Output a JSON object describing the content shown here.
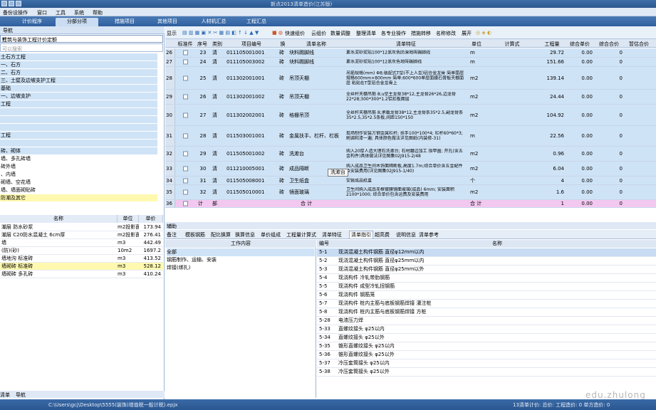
{
  "window": {
    "title": "新点2013清单造价(江苏版)"
  },
  "menu": [
    "备份设操作",
    "窗口",
    "工具",
    "系统",
    "帮助"
  ],
  "tabs": [
    "计价程序",
    "分部分项",
    "措施项目",
    "其他项目",
    "人材机汇总",
    "工程汇总"
  ],
  "left": {
    "header": "导航",
    "selector": "建筑与装饰工程计价定额",
    "search_placeholder": "可以搜索",
    "tree": [
      "土石方工程",
      "一、石方",
      "二、石方",
      "三、土壁及边坡支护工程",
      "基础",
      "一、边坡支护",
      "工程",
      "",
      "",
      " ",
      "工程",
      " ",
      "砖、砌体",
      "墙、多孔砖墙",
      "砖外墙",
      "、内墙",
      "砌墙、空花墙",
      "墙、墙面砌贴砖",
      "防潮及其它"
    ],
    "list_headers": [
      "名称",
      "单位",
      "单价"
    ],
    "list": [
      {
        "name": "潮层 防水砂浆",
        "unit": "m2投影面",
        "price": "173.94"
      },
      {
        "name": "潮层 C20防水混凝土 6cm厚",
        "unit": "m2投影面",
        "price": "276.41"
      },
      {
        "name": "墙",
        "unit": "m3",
        "price": "442.49"
      },
      {
        "name": "(防)(砂)",
        "unit": "10m2",
        "price": "1697.2"
      },
      {
        "name": "墙地沟 标准砖",
        "unit": "m3",
        "price": "413.52"
      },
      {
        "name": "墙砌砖 标准砖",
        "unit": "m3",
        "price": "528.12"
      },
      {
        "name": "墙砌砖 多孔砖",
        "unit": "m3",
        "price": "410.24"
      }
    ],
    "tabs": [
      "清单",
      "导航"
    ]
  },
  "toolbar": [
    "显示",
    "快速组价",
    "云组价",
    "数量调整",
    "整理清单",
    "各专业操作",
    "措施转移",
    "名称修改",
    "展开"
  ],
  "grid": {
    "headers": [
      "",
      "标准件",
      "序号",
      "类别",
      "项目编号",
      "换",
      "清单名称",
      "清单特征",
      "单位",
      "计算式",
      "工程量",
      "综合单价",
      "综合合价",
      "暂估合价"
    ],
    "rows": [
      {
        "n": "26",
        "seq": "23",
        "type": "清",
        "code": "011105001001",
        "unit_mark": "砖",
        "name": "块料踢脚线",
        "feat": "素水泥砂浆贴100*12黑灰色防滑地砖踢脚线",
        "unit": "m",
        "qty": "29.72",
        "price": "0.00",
        "total": "0"
      },
      {
        "n": "27",
        "seq": "24",
        "type": "清",
        "code": "011105003002",
        "unit_mark": "砖",
        "name": "块料踢脚线",
        "feat": "素水泥砂浆贴100*12黑灰色地砖踢脚线",
        "unit": "m",
        "qty": "151.66",
        "price": "0.00",
        "total": "0"
      },
      {
        "n": "28",
        "seq": "25",
        "type": "清",
        "code": "011302001001",
        "unit_mark": "砖",
        "name": "吊顶天棚",
        "feat": "吊筋规格(mm) Φ8;装配式T型(不上人型)铝合金龙骨 简单面层规格600mm×800mm 简单;600*600单层面膜石膏板天棚面层 粘贴在T型铝合金龙骨上",
        "unit": "m2",
        "qty": "139.14",
        "price": "0.00",
        "total": "0"
      },
      {
        "n": "29",
        "seq": "26",
        "type": "清",
        "code": "011302001002",
        "unit_mark": "砖",
        "name": "吊顶天棚",
        "feat": "全丝杆天棚吊筋 8;u型主龙骨38*12,主龙骨26*26,边龙骨22*28;300*300*1.2铝扣板面层",
        "unit": "m2",
        "qty": "24.44",
        "price": "0.00",
        "total": "0"
      },
      {
        "n": "30",
        "seq": "27",
        "type": "清",
        "code": "011302002001",
        "unit_mark": "砖",
        "name": "格栅吊顶",
        "feat": "全丝杆天棚吊筋 8;承载龙骨38*12,主龙骨条35*2.5,副龙骨条35*2.5,35*2.5条板,间距150*150",
        "unit": "m2",
        "qty": "104.92",
        "price": "0.00",
        "total": "0"
      },
      {
        "n": "31",
        "seq": "28",
        "type": "清",
        "code": "011503001001",
        "unit_mark": "砖",
        "name": "金属扶手、栏杆、栏板",
        "feat": "现场制作安装方钢金属栏杆; 扶手100*100*4; 栏杆60*60*3; 刷调和漆一遍; 具体颜色做法详见图纸(内装修-31)",
        "unit": "m",
        "qty": "22.56",
        "price": "0.00",
        "total": "0"
      },
      {
        "n": "32",
        "seq": "29",
        "type": "清",
        "code": "011505001002",
        "unit_mark": "砖",
        "name": "洗漱台",
        "feat": "购入20厚人造大理石洗漱台; 石材磨边加工 指甲圆; 开孔(含五金构件)具体做法详见图集02J915-2/48",
        "unit": "m2",
        "qty": "0.96",
        "price": "0.00",
        "total": "0"
      },
      {
        "n": "33",
        "seq": "30",
        "type": "清",
        "code": "011210005001",
        "unit_mark": "砖",
        "name": "成品隔断",
        "feat": "购入成品卫生间木饰面隔断板,高度1.7m;综合单价含五金配件及安装费用(详见图集02J915-1/40)",
        "unit": "m2",
        "qty": "6.04",
        "price": "0.00",
        "total": "0"
      },
      {
        "n": "34",
        "seq": "31",
        "type": "清",
        "code": "011505008001",
        "unit_mark": "砖",
        "name": "卫生纸盒",
        "feat": "安装成品纸盒",
        "unit": "个",
        "qty": "4",
        "price": "0.00",
        "total": "0"
      },
      {
        "n": "35",
        "seq": "32",
        "type": "清",
        "code": "011505010001",
        "unit_mark": "砖",
        "name": "镜面玻璃",
        "feat": "卫生间购入成品无框镀膜镜面玻璃(成品) 6mm; 安装面积2100*1000; 综合单价包含运费及安装费用",
        "unit": "m2",
        "qty": "1.6",
        "price": "0.00",
        "total": "0"
      }
    ],
    "total_row": {
      "n": "36",
      "col1": "计",
      "col2": "部",
      "name": "合 计",
      "unit": "合 计",
      "qty": "1",
      "price": "0.00",
      "total": "0"
    },
    "tooltip": "洗漱台"
  },
  "bottom_label": "辅助",
  "subtabs": [
    "备注",
    "模板钢筋",
    "配比换算",
    "换算信息",
    "单价组成",
    "工程量计算式",
    "清单特征",
    "清单指引",
    "超高费",
    "说明信息",
    "清单参考"
  ],
  "work": {
    "header": "工作内容",
    "items": [
      "全部",
      "钢筋制作、运输、安装",
      "焊接(绑扎)"
    ]
  },
  "ref": {
    "headers": [
      "编号",
      "名称"
    ],
    "rows": [
      {
        "code": "5-1",
        "name": "现浇混凝土构件钢筋 直径φ12mm以内"
      },
      {
        "code": "5-2",
        "name": "现浇混凝土构件钢筋 直径φ25mm以内"
      },
      {
        "code": "5-3",
        "name": "现浇混凝土构件钢筋 直径φ25mm以外"
      },
      {
        "code": "5-4",
        "name": "现浇构件 冷轧带肋钢筋"
      },
      {
        "code": "5-5",
        "name": "现浇构件 成型冷轧扭钢筋"
      },
      {
        "code": "5-6",
        "name": "现浇构件 钢筋笼"
      },
      {
        "code": "5-7",
        "name": "现浇构件 桩内主筋与底板钢筋焊接 灌注桩"
      },
      {
        "code": "5-8",
        "name": "现浇构件 桩内主筋与底板钢筋焊接 方桩"
      },
      {
        "code": "5-28",
        "name": "电渣压力焊"
      },
      {
        "code": "5-33",
        "name": "直螺纹接头 φ25以内"
      },
      {
        "code": "5-34",
        "name": "直螺纹接头 φ25以外"
      },
      {
        "code": "5-35",
        "name": "锥形直螺纹接头 φ25以内"
      },
      {
        "code": "5-36",
        "name": "锥形直螺纹接头 φ25以外"
      },
      {
        "code": "5-37",
        "name": "冷压套筒接头 φ25以内"
      },
      {
        "code": "5-38",
        "name": "冷压套筒接头 φ25以外"
      }
    ]
  },
  "status": {
    "path": "C:\\Users\\gcj\\Desktop\\5555(装饰)增值税一般计税).epjx",
    "right": "13清单计价: 总价: 工程造价: 0 单方造价: 0"
  },
  "watermark": "edu.zhulong"
}
